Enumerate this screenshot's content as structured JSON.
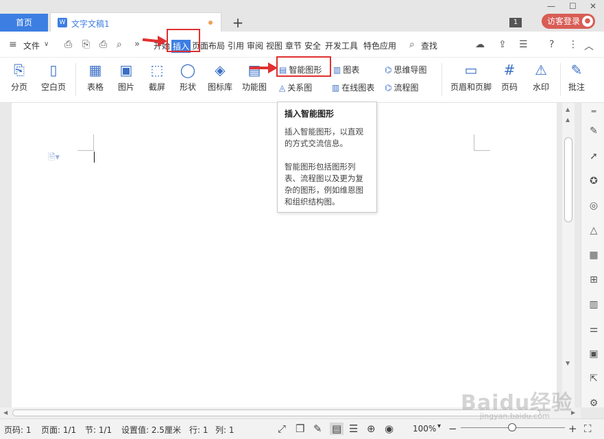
{
  "tabs": {
    "home": "首页",
    "doc_icon": "W",
    "doc_title": "文字文稿1",
    "new_tab": "+",
    "badge": "1",
    "login": "访客登录",
    "minimize": "—",
    "maximize": "☐",
    "close": "✕"
  },
  "menu": {
    "file": "文件",
    "items": [
      "开始",
      "插入",
      "页面布局",
      "引用",
      "审阅",
      "视图",
      "章节",
      "安全",
      "开发工具",
      "特色应用"
    ],
    "search": "查找",
    "help": "?",
    "more": "⋮",
    "collapse": "︿"
  },
  "toolbar": {
    "fenye": "分页",
    "kongbaiye": "空白页",
    "biaoge": "表格",
    "tupian": "图片",
    "jieping": "截屏",
    "xingzhuang": "形状",
    "tubiaoku": "图标库",
    "gongnengtu": "功能图",
    "zhinengtuxing": "智能图形",
    "guanxitu": "关系图",
    "tubiao": "图表",
    "zaixiantubiao": "在线图表",
    "siweidaotu": "思维导图",
    "liuchengtu": "流程图",
    "yemeiheyejiao": "页眉和页脚",
    "yema": "页码",
    "shuiyin": "水印",
    "pizhu": "批注"
  },
  "tooltip": {
    "title": "插入智能图形",
    "desc1": "插入智能图形，以直观的方式交流信息。",
    "desc2": "智能图形包括图形列表、流程图以及更为复杂的图形，例如维恩图和组织结构图。"
  },
  "status": {
    "page": "页码: 1",
    "pages": "页面: 1/1",
    "section": "节: 1/1",
    "setting": "设置值: 2.5厘米",
    "row": "行: 1",
    "col": "列: 1",
    "zoom": "100%"
  },
  "watermark": {
    "logo": "Baidu经验",
    "url": "jingyan.baidu.com"
  },
  "colors": {
    "accent": "#3d7ee2",
    "login": "#d85d55",
    "annotation": "#e03030"
  }
}
